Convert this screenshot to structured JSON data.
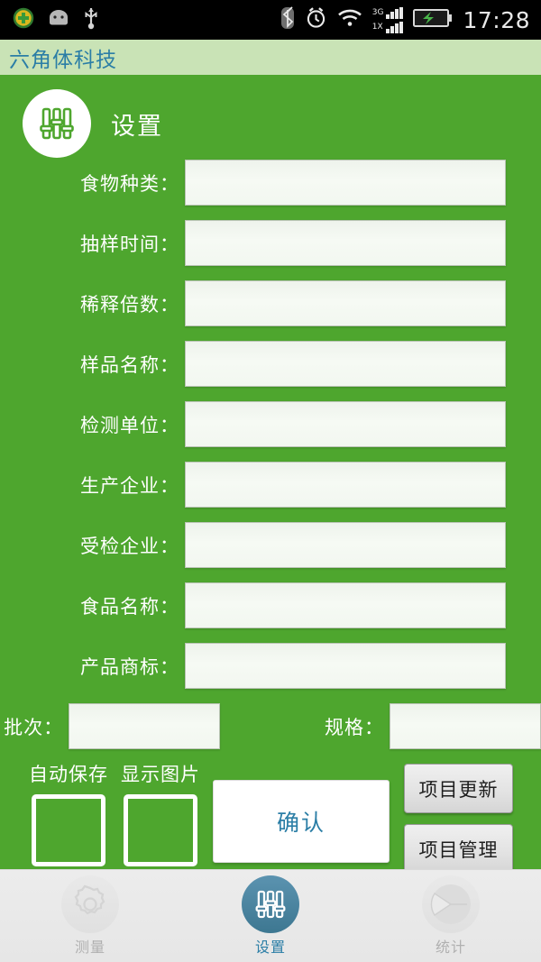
{
  "statusbar": {
    "time": "17:28",
    "network_3g": "3G",
    "network_1x": "1X",
    "left_icons": [
      "plus-circle-icon",
      "android-robot-icon",
      "usb-icon"
    ],
    "right_icons": [
      "bluetooth-icon",
      "alarm-clock-icon",
      "wifi-icon",
      "signal-bars-icon",
      "battery-charging-icon"
    ]
  },
  "titlebar": {
    "app_title": "六角体科技",
    "title_color": "#2b7ea6",
    "background": "#c9e3b6"
  },
  "page": {
    "icon": "sliders-icon",
    "title": "设置",
    "background": "#4ea62e"
  },
  "form": {
    "fields": [
      {
        "label": "食物种类：",
        "value": "",
        "name": "food-type-input"
      },
      {
        "label": "抽样时间：",
        "value": "",
        "name": "sampling-time-input"
      },
      {
        "label": "稀释倍数：",
        "value": "",
        "name": "dilution-factor-input"
      },
      {
        "label": "样品名称：",
        "value": "",
        "name": "sample-name-input"
      },
      {
        "label": "检测单位：",
        "value": "",
        "name": "testing-unit-input"
      },
      {
        "label": "生产企业：",
        "value": "",
        "name": "manufacturer-input"
      },
      {
        "label": "受检企业：",
        "value": "",
        "name": "inspected-company-input"
      },
      {
        "label": "食品名称：",
        "value": "",
        "name": "food-name-input"
      },
      {
        "label": "产品商标：",
        "value": "",
        "name": "product-trademark-input"
      }
    ],
    "batch": {
      "label": "批次：",
      "value": ""
    },
    "spec": {
      "label": "规格：",
      "value": ""
    }
  },
  "controls": {
    "checkboxes": [
      {
        "label": "自动保存",
        "checked": false
      },
      {
        "label": "显示图片",
        "checked": false
      }
    ],
    "confirm_button": "确认",
    "side_buttons": [
      "项目更新",
      "项目管理"
    ]
  },
  "navbar": {
    "items": [
      {
        "label": "测量",
        "icon": "gear-icon",
        "active": false
      },
      {
        "label": "设置",
        "icon": "sliders-icon",
        "active": true
      },
      {
        "label": "统计",
        "icon": "pie-chart-icon",
        "active": false
      }
    ],
    "active_color": "#2b7ea6",
    "inactive_color": "#b0b0b0"
  }
}
